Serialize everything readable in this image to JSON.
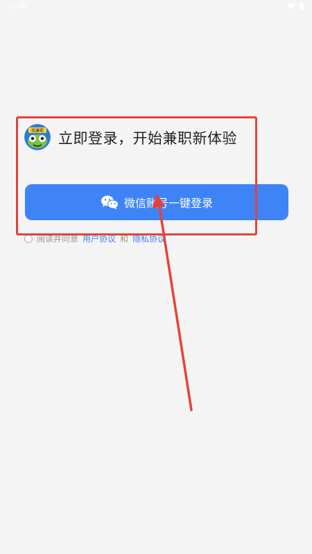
{
  "status_bar": {
    "time": "11:08",
    "icons": [
      "wifi-icon",
      "battery-icon"
    ]
  },
  "login": {
    "logo_icon": "app-logo",
    "logo_text": "找兼职",
    "headline": "立即登录，开始兼职新体验",
    "wechat_button_label": "微信账号一键登录",
    "wechat_icon": "wechat-icon"
  },
  "agreement": {
    "prefix": "阅读并同意",
    "user_agreement": "用户协议",
    "conjunction": "和",
    "privacy_policy": "隐私协议"
  },
  "colors": {
    "primary": "#3f84f6",
    "annotation": "#e6413a",
    "background": "#f4f4f4"
  }
}
